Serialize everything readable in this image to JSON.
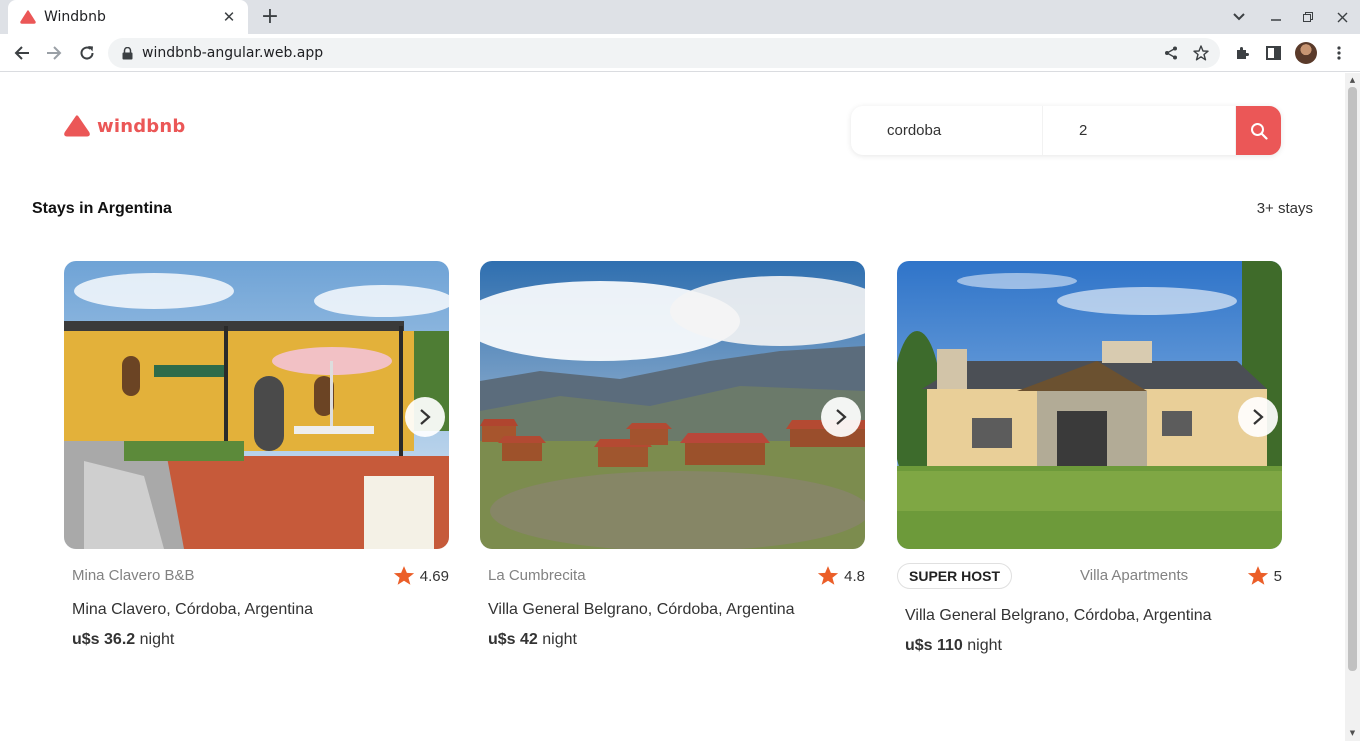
{
  "browser": {
    "tab_title": "Windbnb",
    "url": "windbnb-angular.web.app"
  },
  "brand": {
    "name": "windbnb",
    "accent": "#eb5757"
  },
  "search": {
    "location": "cordoba",
    "guests": "2"
  },
  "section": {
    "title": "Stays in Argentina",
    "count": "3+ stays"
  },
  "stays": [
    {
      "name": "Mina Clavero B&B",
      "rating": "4.69",
      "address": "Mina Clavero, Córdoba, Argentina",
      "price": "u$s 36.2",
      "unit": "night",
      "superhost": false
    },
    {
      "name": "La Cumbrecita",
      "rating": "4.8",
      "address": "Villa General Belgrano, Córdoba, Argentina",
      "price": "u$s 42",
      "unit": "night",
      "superhost": false
    },
    {
      "name": "Villa Apartments",
      "rating": "5",
      "address": "Villa General Belgrano, Córdoba, Argentina",
      "price": "u$s 110",
      "unit": "night",
      "superhost": true,
      "superhost_label": "SUPER HOST"
    }
  ]
}
